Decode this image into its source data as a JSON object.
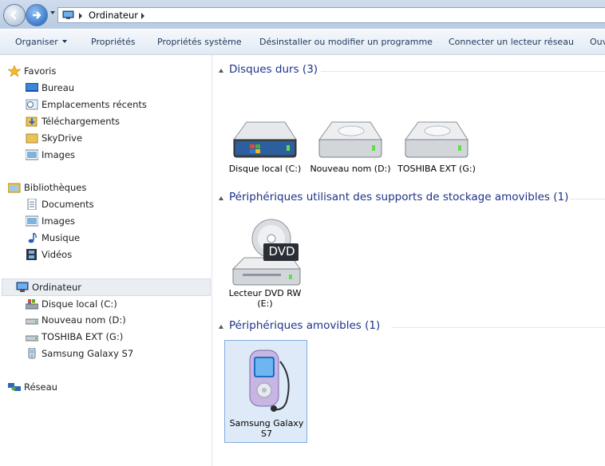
{
  "window": {
    "address": {
      "icon": "computer-icon",
      "segments": [
        "Ordinateur"
      ]
    }
  },
  "toolbar": {
    "organise": "Organiser",
    "properties": "Propriétés",
    "system_properties": "Propriétés système",
    "uninstall": "Désinstaller ou modifier un programme",
    "map_drive": "Connecter un lecteur réseau",
    "open_panel": "Ouv"
  },
  "nav": {
    "favorites": {
      "label": "Favoris",
      "items": [
        "Bureau",
        "Emplacements récents",
        "Téléchargements",
        "SkyDrive",
        "Images"
      ]
    },
    "libraries": {
      "label": "Bibliothèques",
      "items": [
        "Documents",
        "Images",
        "Musique",
        "Vidéos"
      ]
    },
    "computer": {
      "label": "Ordinateur",
      "items": [
        "Disque local (C:)",
        "Nouveau nom (D:)",
        "TOSHIBA EXT (G:)",
        "Samsung Galaxy S7"
      ]
    },
    "network": {
      "label": "Réseau"
    }
  },
  "content": {
    "groups": [
      {
        "header": "Disques durs (3)",
        "items": [
          {
            "label": "Disque local (C:)",
            "icon": "system-drive-icon"
          },
          {
            "label": "Nouveau nom (D:)",
            "icon": "hard-drive-icon"
          },
          {
            "label": "TOSHIBA EXT (G:)",
            "icon": "hard-drive-icon"
          }
        ]
      },
      {
        "header": "Périphériques utilisant des supports de stockage amovibles (1)",
        "items": [
          {
            "label": "Lecteur DVD RW (E:)",
            "icon": "dvd-drive-icon",
            "badge": "DVD"
          }
        ]
      },
      {
        "header": "Périphériques amovibles (1)",
        "items": [
          {
            "label": "Samsung Galaxy S7",
            "icon": "portable-device-icon",
            "selected": true
          }
        ]
      }
    ]
  }
}
